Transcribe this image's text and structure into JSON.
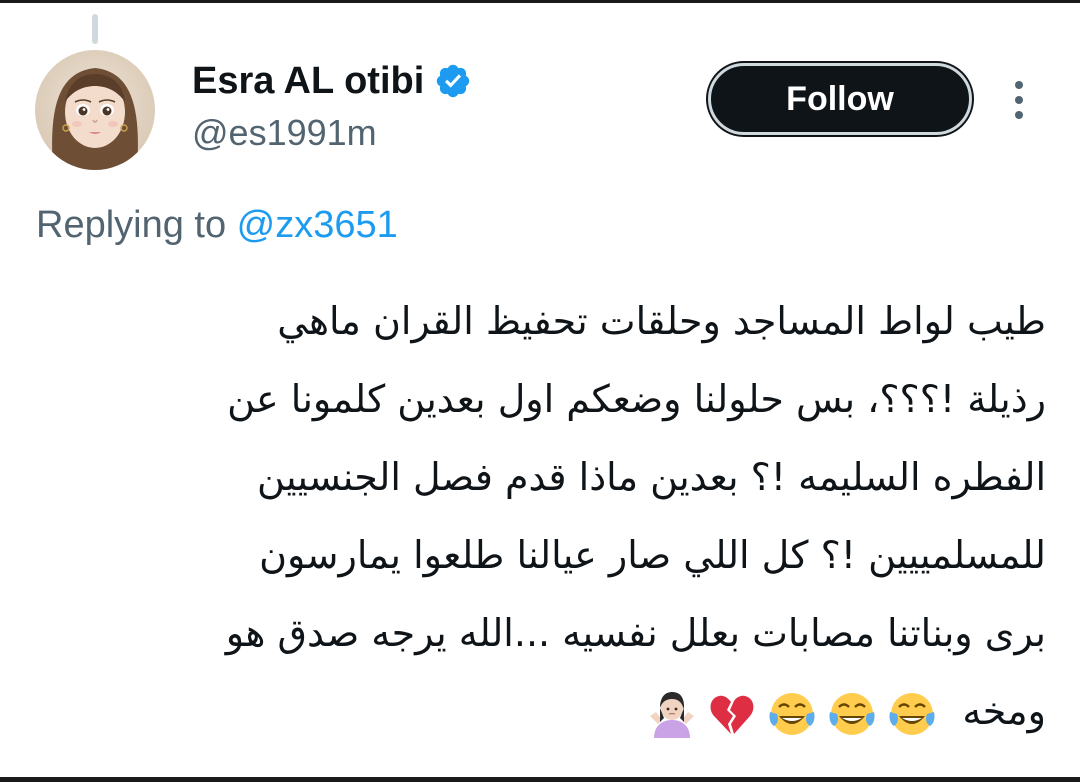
{
  "author": {
    "display_name": "Esra AL otibi",
    "handle": "@es1991m",
    "verified": true
  },
  "follow_button": {
    "label": "Follow"
  },
  "reply": {
    "prefix": "Replying to ",
    "mention": "@zx3651"
  },
  "tweet": {
    "lines": [
      "طيب لواط المساجد وحلقات تحفيظ القران ماهي",
      "رذيلة !؟؟؟، بس حلولنا وضعكم اول بعدين كلمونا عن",
      "الفطره السليمه !؟ بعدين ماذا قدم فصل الجنسيين",
      "للمسلمييين !؟ كل اللي صار عيالنا طلعوا يمارسون",
      "برى وبناتنا مصابات بعلل نفسيه ...الله يرجه صدق هو",
      "ومخه"
    ],
    "emojis": [
      "face-with-tears-of-joy",
      "face-with-tears-of-joy",
      "face-with-tears-of-joy",
      "broken-heart",
      "person-shrugging"
    ]
  },
  "colors": {
    "accent": "#1d9bf0",
    "text": "#0f1419",
    "secondary": "#536471",
    "button": "#0f1419"
  }
}
